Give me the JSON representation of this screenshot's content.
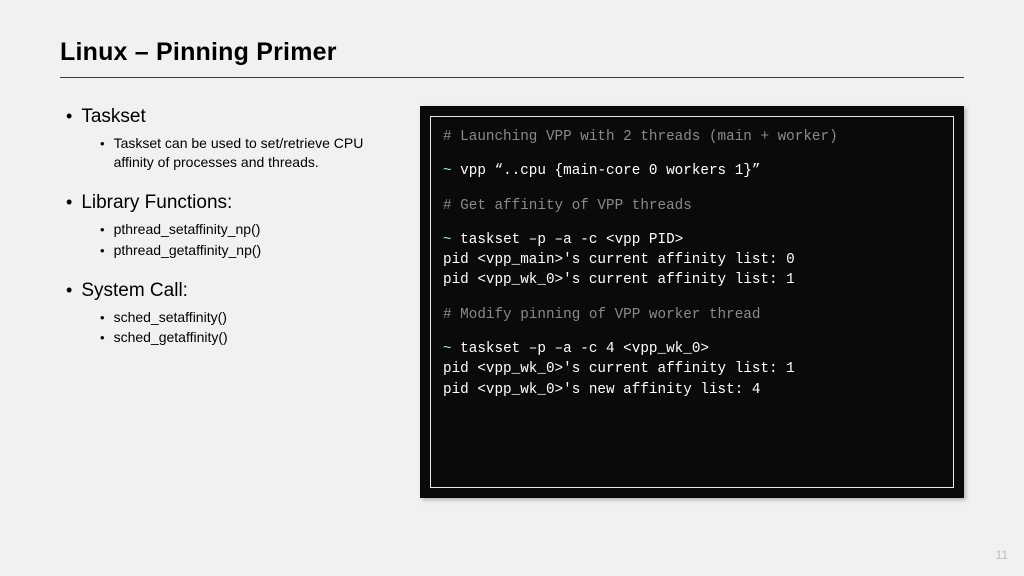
{
  "title": "Linux – Pinning Primer",
  "left": {
    "sections": [
      {
        "heading": "Taskset",
        "items": [
          "Taskset can be used to set/retrieve CPU affinity of processes and threads."
        ]
      },
      {
        "heading": "Library Functions:",
        "items": [
          "pthread_setaffinity_np()",
          "pthread_getaffinity_np()"
        ]
      },
      {
        "heading": "System Call:",
        "items": [
          "sched_setaffinity()",
          "sched_getaffinity()"
        ]
      }
    ]
  },
  "terminal": {
    "c1": "# Launching VPP with 2 threads (main + worker)",
    "l1p": "~ ",
    "l1c": "vpp “..cpu {main-core 0 workers 1}”",
    "c2": "# Get affinity of VPP threads",
    "l2p": "~ ",
    "l2c": "taskset –p –a -c <vpp PID>",
    "o1": "pid <vpp_main>'s current affinity list: 0",
    "o2": "pid <vpp_wk_0>'s current affinity list: 1",
    "c3": "# Modify pinning of VPP worker thread",
    "l3p": "~ ",
    "l3c": "taskset –p –a -c 4 <vpp_wk_0>",
    "o3": "pid <vpp_wk_0>'s current affinity list: 1",
    "o4": "pid <vpp_wk_0>'s new affinity list: 4"
  },
  "pageNumber": "11"
}
